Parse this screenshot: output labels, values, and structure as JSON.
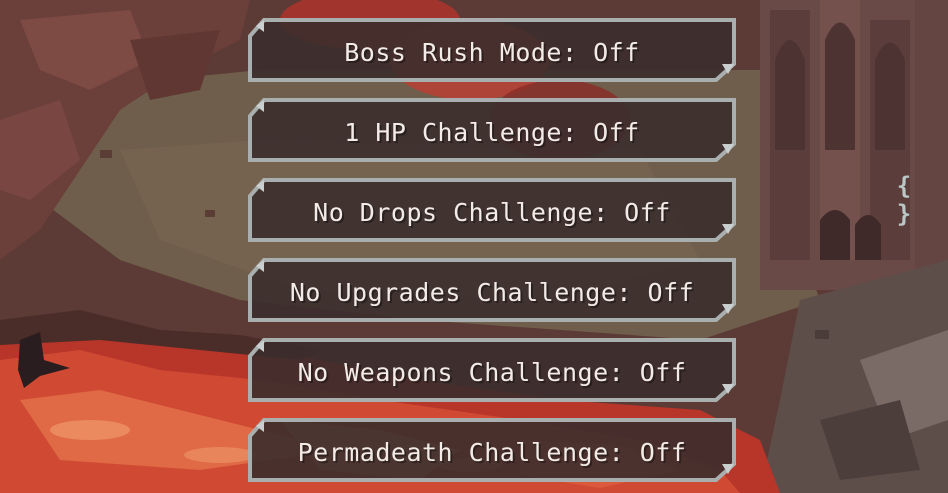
{
  "menu": {
    "options": [
      {
        "label": "Boss Rush Mode: Off"
      },
      {
        "label": "1 HP Challenge: Off"
      },
      {
        "label": "No Drops Challenge: Off"
      },
      {
        "label": "No Upgrades Challenge: Off"
      },
      {
        "label": "No Weapons Challenge: Off"
      },
      {
        "label": "Permadeath Challenge: Off"
      }
    ]
  },
  "indicator": {
    "glyph": "{ }"
  },
  "colors": {
    "button_fill": "#3a2b2a",
    "button_border": "#a7adad",
    "text": "#f3ece6",
    "lava": "#c23a28",
    "floor": "#6e5b4a",
    "wall": "#6c4b48"
  }
}
